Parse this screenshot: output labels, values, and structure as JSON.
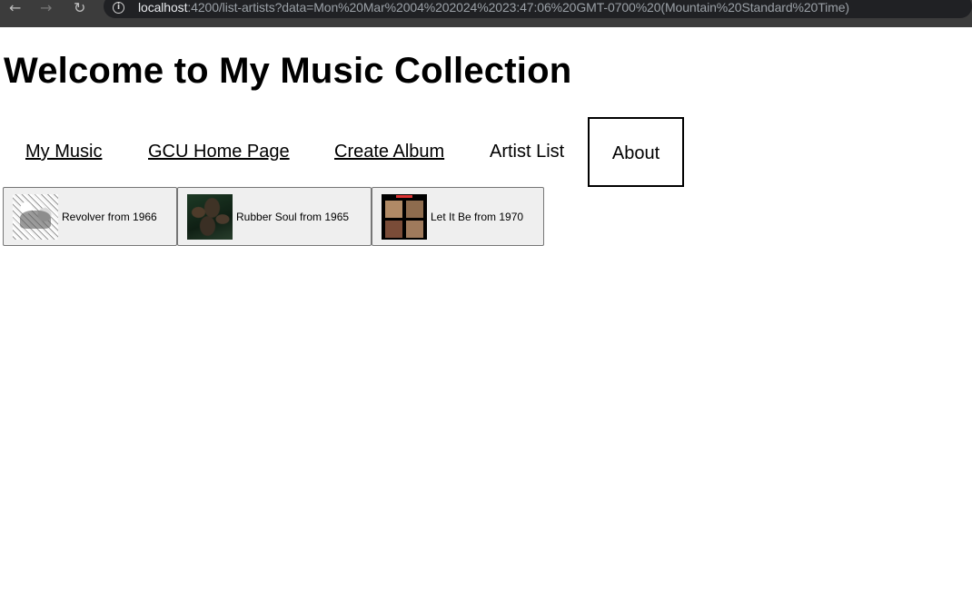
{
  "browser": {
    "nav_icons": {
      "back": "arrow-left",
      "forward": "arrow-right",
      "reload": "reload",
      "site_info": "info"
    },
    "url_host": "localhost",
    "url_rest": ":4200/list-artists?data=Mon%20Mar%2004%202024%2023:47:06%20GMT-0700%20(Mountain%20Standard%20Time)"
  },
  "page": {
    "heading": "Welcome to My Music Collection"
  },
  "menu": {
    "my_music": "My Music",
    "gcu_home": "GCU Home Page",
    "create_album": "Create Album",
    "artist_list": "Artist List",
    "about": "About"
  },
  "albums": [
    {
      "label": "Revolver from 1966"
    },
    {
      "label": "Rubber Soul from 1965"
    },
    {
      "label": "Let It Be from 1970"
    }
  ]
}
